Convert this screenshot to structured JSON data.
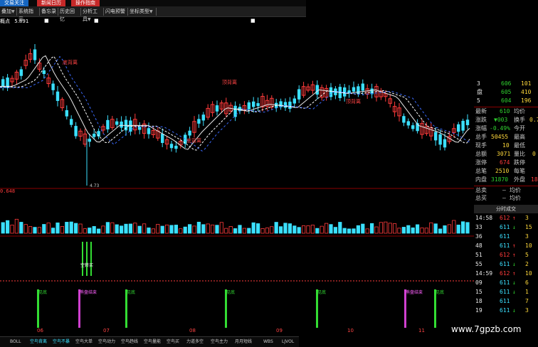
{
  "top_tabs": [
    {
      "label": "交易关注"
    },
    {
      "label": "新闻日历"
    },
    {
      "label": "操作指南"
    }
  ],
  "toolbar": [
    {
      "label": "叠加",
      "caret": "▼"
    },
    {
      "label": "系统指示",
      "caret": ""
    },
    {
      "label": "备忘录",
      "caret": ""
    },
    {
      "label": "历史回忆",
      "caret": ""
    },
    {
      "label": "分析工具",
      "caret": "▼"
    },
    {
      "label": "闪电预警",
      "caret": ""
    },
    {
      "label": "坐标类型",
      "caret": "▼"
    }
  ],
  "overlay_label": "概点",
  "overlay_value": "5.891",
  "chart_data": {
    "type": "candlestick",
    "annotations": [
      "顶背离",
      "底背离",
      "顶背离",
      "底背离"
    ],
    "low_label": "4.73",
    "volume_value": "0.648",
    "signal_label": "空转买",
    "event_labels": [
      "见底",
      "熊盘结束",
      "见底",
      "见底",
      "见底",
      "熊盘结束",
      "见底"
    ],
    "date_labels": [
      "06",
      "07",
      "08",
      "09",
      "10",
      "11"
    ]
  },
  "order_book": [
    {
      "level": "3",
      "price": "606",
      "vol": "101"
    },
    {
      "level": "盘",
      "price": "605",
      "vol": "410"
    },
    {
      "level": "5",
      "price": "604",
      "vol": "196"
    }
  ],
  "quote": [
    {
      "k1": "最新",
      "v1": "610",
      "k2": "均价",
      "v2": ""
    },
    {
      "k1": "涨跌",
      "v1": "▼003",
      "k2": "换手",
      "v2": "0.7"
    },
    {
      "k1": "涨幅",
      "v1": "-0.49%",
      "k2": "今开",
      "v2": ""
    },
    {
      "k1": "总手",
      "v1": "50455",
      "k2": "最高",
      "v2": ""
    },
    {
      "k1": "现手",
      "v1": "10",
      "k2": "最低",
      "v2": ""
    },
    {
      "k1": "总额",
      "v1": "3071",
      "k2": "量比",
      "v2": "0"
    },
    {
      "k1": "涨停",
      "v1": "674",
      "k2": "跌停",
      "v2": ""
    },
    {
      "k1": "总笔",
      "v1": "2510",
      "k2": "每笔",
      "v2": ""
    },
    {
      "k1": "内盘",
      "v1": "31870",
      "k2": "外盘",
      "v2": "18"
    },
    {
      "k1": "总卖",
      "v1": "",
      "k2": "均价",
      "v2": ""
    },
    {
      "k1": "总买",
      "v1": "",
      "k2": "均价",
      "v2": ""
    }
  ],
  "ticks_header": "分时成交",
  "ticks": [
    {
      "time": "14:58",
      "price": "612",
      "arrow": "↑",
      "vol": "3"
    },
    {
      "time": "33",
      "price": "611",
      "arrow": "↓",
      "vol": "15"
    },
    {
      "time": "36",
      "price": "611",
      "arrow": "",
      "vol": "3"
    },
    {
      "time": "48",
      "price": "611",
      "arrow": "↑",
      "vol": "10"
    },
    {
      "time": "51",
      "price": "612",
      "arrow": "↑",
      "vol": "5"
    },
    {
      "time": "55",
      "price": "611",
      "arrow": "↓",
      "vol": "2"
    },
    {
      "time": "14:59",
      "price": "612",
      "arrow": "↑",
      "vol": "10"
    },
    {
      "time": "09",
      "price": "611",
      "arrow": "↓",
      "vol": "6"
    },
    {
      "time": "15",
      "price": "611",
      "arrow": "↓",
      "vol": "1"
    },
    {
      "time": "18",
      "price": "611",
      "arrow": "",
      "vol": "7"
    },
    {
      "time": "19",
      "price": "611",
      "arrow": "↓",
      "vol": "3"
    }
  ],
  "bottom_tabs": [
    {
      "label": "BOLL"
    },
    {
      "label": "空鸟背离"
    },
    {
      "label": "空鸟不暴"
    },
    {
      "label": "空鸟大单"
    },
    {
      "label": "空鸟动力"
    },
    {
      "label": "空鸟趋线"
    },
    {
      "label": "空鸟量能"
    },
    {
      "label": "空鸟买"
    },
    {
      "label": "力道多空"
    },
    {
      "label": "空鸟主力"
    },
    {
      "label": "月月短线"
    },
    {
      "label": "WBS"
    },
    {
      "label": "LJVOL"
    }
  ],
  "watermark": "www.7gpzb.com"
}
